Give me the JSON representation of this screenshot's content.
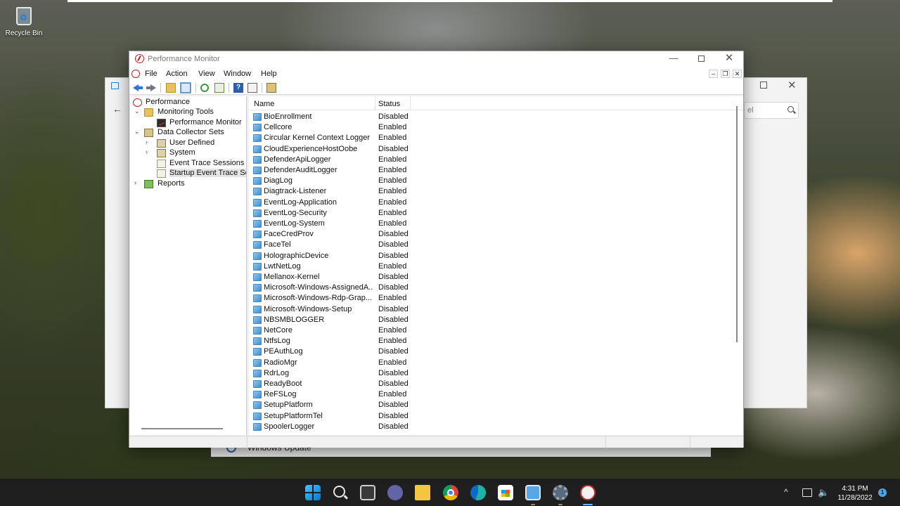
{
  "desktop": {
    "recycle_bin_label": "Recycle Bin"
  },
  "background_window": {
    "search_placeholder": "el",
    "footer_item": "Windows Update"
  },
  "window": {
    "title": "Performance Monitor",
    "controls": {
      "minimize": "—",
      "maximize": "□",
      "close": "✕"
    }
  },
  "menubar": {
    "items": [
      "File",
      "Action",
      "View",
      "Window",
      "Help"
    ],
    "mdi": {
      "minimize": "–",
      "restore": "❐",
      "close": "✕"
    }
  },
  "toolbar": {
    "buttons": [
      "back-icon",
      "forward-icon",
      "up-folder-icon",
      "show-hide-tree-icon",
      "refresh-icon",
      "export-list-icon",
      "help-icon",
      "properties-icon",
      "new-window-icon"
    ],
    "help_glyph": "?"
  },
  "tree": {
    "items": [
      {
        "label": "Performance",
        "expander": "",
        "icon": "performance-icon"
      },
      {
        "label": "Monitoring Tools",
        "expander": "⌄",
        "icon": "folder-icon"
      },
      {
        "label": "Performance Monitor",
        "expander": "",
        "icon": "monitor-icon"
      },
      {
        "label": "Data Collector Sets",
        "expander": "⌄",
        "icon": "data-collector-icon"
      },
      {
        "label": "User Defined",
        "expander": "›",
        "icon": "collector-set-icon"
      },
      {
        "label": "System",
        "expander": "›",
        "icon": "collector-set-icon"
      },
      {
        "label": "Event Trace Sessions",
        "expander": "",
        "icon": "trace-session-icon"
      },
      {
        "label": "Startup Event Trace Sessions",
        "expander": "",
        "icon": "trace-session-icon",
        "selected": true
      },
      {
        "label": "Reports",
        "expander": "›",
        "icon": "reports-icon"
      }
    ]
  },
  "list": {
    "columns": {
      "name": "Name",
      "status": "Status"
    },
    "rows": [
      {
        "name": "BioEnrollment",
        "status": "Disabled"
      },
      {
        "name": "Cellcore",
        "status": "Enabled"
      },
      {
        "name": "Circular Kernel Context Logger",
        "status": "Enabled"
      },
      {
        "name": "CloudExperienceHostOobe",
        "status": "Disabled"
      },
      {
        "name": "DefenderApiLogger",
        "status": "Enabled"
      },
      {
        "name": "DefenderAuditLogger",
        "status": "Enabled"
      },
      {
        "name": "DiagLog",
        "status": "Enabled"
      },
      {
        "name": "Diagtrack-Listener",
        "status": "Enabled"
      },
      {
        "name": "EventLog-Application",
        "status": "Enabled"
      },
      {
        "name": "EventLog-Security",
        "status": "Enabled"
      },
      {
        "name": "EventLog-System",
        "status": "Enabled"
      },
      {
        "name": "FaceCredProv",
        "status": "Disabled"
      },
      {
        "name": "FaceTel",
        "status": "Disabled"
      },
      {
        "name": "HolographicDevice",
        "status": "Disabled"
      },
      {
        "name": "LwtNetLog",
        "status": "Enabled"
      },
      {
        "name": "Mellanox-Kernel",
        "status": "Disabled"
      },
      {
        "name": "Microsoft-Windows-AssignedA...",
        "status": "Disabled"
      },
      {
        "name": "Microsoft-Windows-Rdp-Grap...",
        "status": "Enabled"
      },
      {
        "name": "Microsoft-Windows-Setup",
        "status": "Disabled"
      },
      {
        "name": "NBSMBLOGGER",
        "status": "Disabled"
      },
      {
        "name": "NetCore",
        "status": "Enabled"
      },
      {
        "name": "NtfsLog",
        "status": "Enabled"
      },
      {
        "name": "PEAuthLog",
        "status": "Disabled"
      },
      {
        "name": "RadioMgr",
        "status": "Enabled"
      },
      {
        "name": "RdrLog",
        "status": "Disabled"
      },
      {
        "name": "ReadyBoot",
        "status": "Disabled"
      },
      {
        "name": "ReFSLog",
        "status": "Enabled"
      },
      {
        "name": "SetupPlatform",
        "status": "Disabled"
      },
      {
        "name": "SetupPlatformTel",
        "status": "Disabled"
      },
      {
        "name": "SpoolerLogger",
        "status": "Disabled"
      }
    ]
  },
  "taskbar": {
    "apps": [
      "start-icon",
      "search-icon",
      "task-view-icon",
      "chat-icon",
      "file-explorer-icon",
      "chrome-icon",
      "edge-icon",
      "store-icon",
      "remote-desktop-icon",
      "settings-icon",
      "performance-monitor-icon"
    ],
    "tray": {
      "chevron": "^",
      "volume": "🔈"
    },
    "clock": {
      "time": "4:31 PM",
      "date": "11/28/2022"
    },
    "notification_count": "1"
  }
}
